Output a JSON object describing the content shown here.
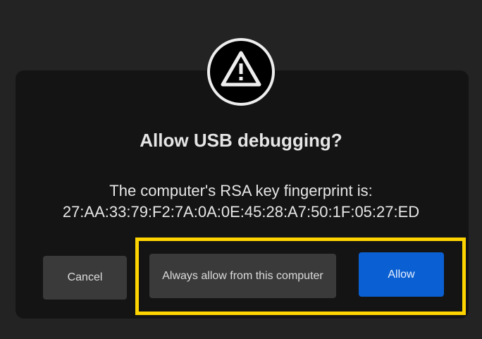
{
  "dialog": {
    "icon": "warning-triangle-icon",
    "title": "Allow USB debugging?",
    "body_line1": "The computer's RSA key fingerprint is:",
    "fingerprint": "27:AA:33:79:F2:7A:0A:0E:45:28:A7:50:1F:05:27:ED",
    "buttons": {
      "cancel": "Cancel",
      "always_allow": "Always allow from this computer",
      "allow": "Allow"
    }
  },
  "colors": {
    "accent": "#0a60d2",
    "highlight": "#ffd400"
  }
}
